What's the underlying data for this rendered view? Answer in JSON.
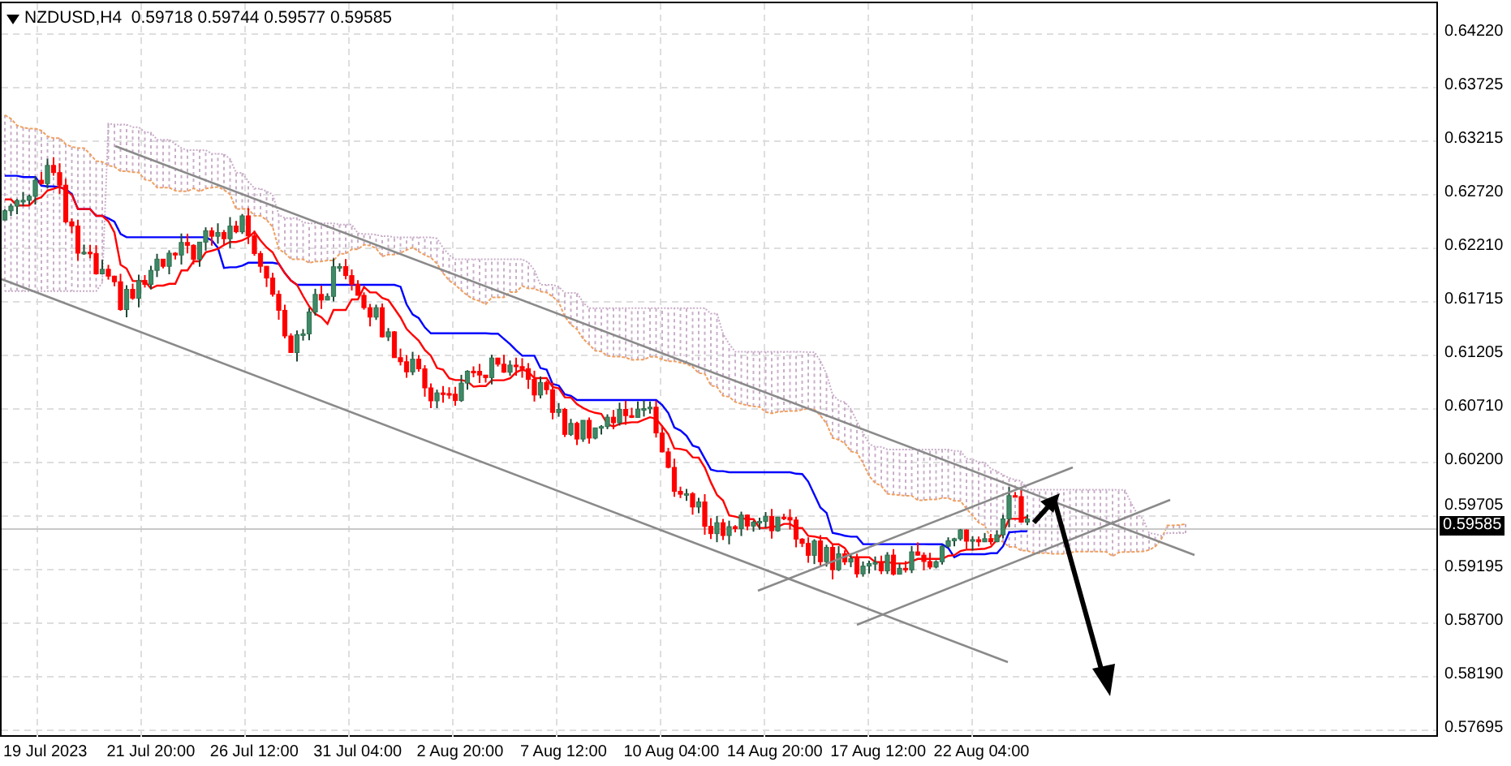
{
  "chart": {
    "title": "NZDUSD,H4  0.59718 0.59744 0.59577 0.59585"
  },
  "price_axis": {
    "labels": [
      "0.64220",
      "0.63725",
      "0.63215",
      "0.62720",
      "0.62210",
      "0.61715",
      "0.61205",
      "0.60710",
      "0.60200",
      "0.59705",
      "0.59195",
      "0.58700",
      "0.58190",
      "0.57695"
    ],
    "current_price": "0.59585"
  },
  "time_axis": {
    "labels": [
      "19 Jul 2023",
      "21 Jul 20:00",
      "26 Jul 12:00",
      "31 Jul 04:00",
      "2 Aug 20:00",
      "7 Aug 12:00",
      "10 Aug 04:00",
      "14 Aug 20:00",
      "17 Aug 12:00",
      "22 Aug 04:00"
    ]
  }
}
